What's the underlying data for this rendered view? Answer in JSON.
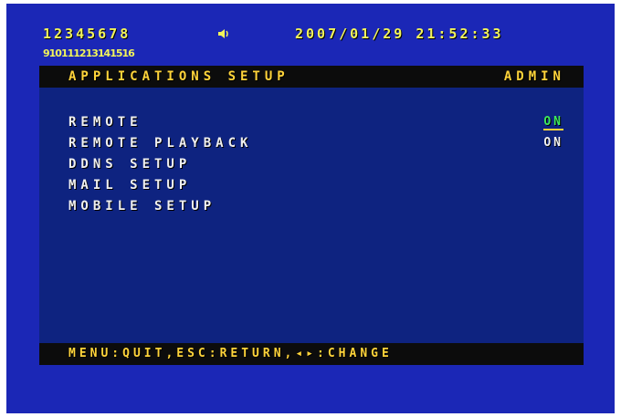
{
  "status_bar": {
    "channels_1_8": "12345678",
    "channels_9_16": "910111213141516",
    "datetime": "2007/01/29  21:52:33"
  },
  "header": {
    "title": "APPLICATIONS SETUP",
    "user": "ADMIN"
  },
  "menu": {
    "items": [
      {
        "label": "REMOTE",
        "value": "ON"
      },
      {
        "label": "REMOTE PLAYBACK",
        "value": "ON"
      },
      {
        "label": "DDNS SETUP"
      },
      {
        "label": "MAIL SETUP"
      },
      {
        "label": "MOBILE SETUP"
      }
    ]
  },
  "footer": {
    "hint": "MENU:QUIT,ESC:RETURN,◂▸:CHANGE"
  },
  "colors": {
    "background": "#1b27b6",
    "panel": "#0e2380",
    "bar": "#0c0c0c",
    "accent": "#ffd43a",
    "selected_value": "#3ee85a"
  },
  "icons": {
    "audio": "speaker-icon"
  }
}
